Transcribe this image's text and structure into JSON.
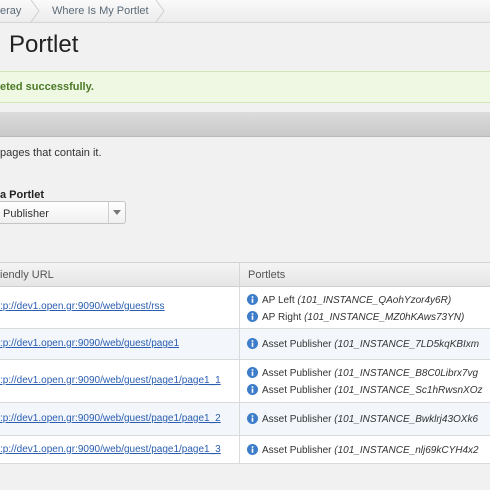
{
  "breadcrumb": {
    "items": [
      "eray",
      "Where Is My Portlet"
    ]
  },
  "page_title": "Portlet",
  "alert": {
    "text": "eted successfully."
  },
  "description": "pages that contain it.",
  "select": {
    "label": "a Portlet",
    "value": "Publisher"
  },
  "table": {
    "headers": {
      "url": "iendly URL",
      "portlets": "Portlets"
    },
    "rows": [
      {
        "url": ":p://dev1.open.gr:9090/web/guest/rss",
        "portlets": [
          {
            "name": "AP Left",
            "instance": "(101_INSTANCE_QAohYzor4y6R)"
          },
          {
            "name": "AP Right",
            "instance": "(101_INSTANCE_MZ0hKAws73YN)"
          }
        ]
      },
      {
        "url": ":p://dev1.open.gr:9090/web/guest/page1",
        "portlets": [
          {
            "name": "Asset Publisher",
            "instance": "(101_INSTANCE_7LD5kqKBIxm"
          }
        ]
      },
      {
        "url": ":p://dev1.open.gr:9090/web/guest/page1/page1_1",
        "portlets": [
          {
            "name": "Asset Publisher",
            "instance": "(101_INSTANCE_B8C0Librx7vg"
          },
          {
            "name": "Asset Publisher",
            "instance": "(101_INSTANCE_Sc1hRwsnXOz"
          }
        ]
      },
      {
        "url": ":p://dev1.open.gr:9090/web/guest/page1/page1_2",
        "portlets": [
          {
            "name": "Asset Publisher",
            "instance": "(101_INSTANCE_Bwklrj43OXk6"
          }
        ]
      },
      {
        "url": ":p://dev1.open.gr:9090/web/guest/page1/page1_3",
        "portlets": [
          {
            "name": "Asset Publisher",
            "instance": "(101_INSTANCE_nlj69kCYH4x2"
          }
        ]
      }
    ]
  },
  "icons": {
    "info": "info-icon",
    "select_arrow": "chevron-down-icon"
  },
  "colors": {
    "link": "#2a5db0",
    "info_icon": "#3d7cc9",
    "alert_text": "#4c7a27",
    "alert_bg": "#eef8e3"
  }
}
